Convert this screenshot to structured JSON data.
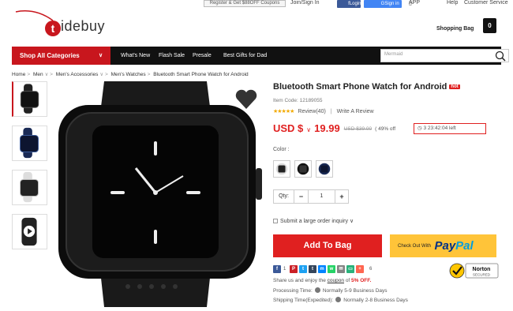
{
  "topbar": {
    "register": "Register & Get $88OFF Coupons",
    "join": "Join/Sign In",
    "facebook": "Login",
    "google": "Sign in",
    "app": "APP",
    "help": "Help",
    "customer_service": "Customer Service"
  },
  "logo": {
    "text": "idebuy",
    "letter": "t"
  },
  "bag": {
    "label": "Shopping Bag",
    "count": "0"
  },
  "nav": {
    "all_categories": "Shop All Categories",
    "links": [
      "What's New",
      "Flash Sale",
      "Presale",
      "Best Gifts for Dad"
    ],
    "search_placeholder": "Mermaid"
  },
  "breadcrumb": [
    "Home",
    "Men",
    "Men's Accessories",
    "Men's Watches",
    "Bluetooth Smart Phone Watch for Android"
  ],
  "product": {
    "title": "Bluetooth Smart Phone Watch for Android",
    "hot_badge": "hot",
    "item_code": "Item Code: 12189055",
    "stars": "★★★★★",
    "rating": 4,
    "reviews": "Review(40)",
    "write_review": "Write A Review",
    "currency": "USD $",
    "price": "19.99",
    "old_price": "USD $39.00",
    "discount": "( 49% off",
    "timer": "3 23:42:04 left",
    "color_label": "Color :",
    "colors": [
      "white",
      "black",
      "blue"
    ],
    "qty_label": "Qty:",
    "qty_value": "1",
    "bulk_inquiry": "Submit a large order inquiry",
    "add_to_bag": "Add To Bag",
    "paypal_prefix": "Check Out With",
    "paypal_pay": "Pay",
    "paypal_pal": "Pal"
  },
  "share": {
    "fb_count": "1",
    "plus_count": "6",
    "text_pre": "Share us and enjoy the",
    "coupon": "coupon",
    "text_mid": "of",
    "pct": "5% OFF.",
    "norton": "Norton",
    "norton_sub": "SECURED"
  },
  "shipping": {
    "processing_label": "Processing Time:",
    "processing_value": "Normally 5-9 Business Days",
    "expedited_label": "Shipping Time(Expedited):",
    "expedited_value": "Normally 2-8 Business Days"
  },
  "colors": {
    "brand_red": "#c8161d",
    "price_red": "#e02020",
    "paypal_yellow": "#ffc439",
    "nav_black": "#111111"
  }
}
